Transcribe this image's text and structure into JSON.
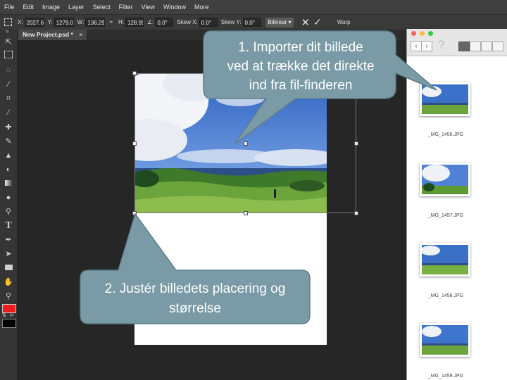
{
  "menu": [
    "File",
    "Edit",
    "Image",
    "Layer",
    "Select",
    "Filter",
    "View",
    "Window",
    "More"
  ],
  "options": {
    "x_label": "X:",
    "x_value": "2027.6",
    "y_label": "Y:",
    "y_value": "1279.0",
    "w_label": "W:",
    "w_value": "136.29",
    "link_symbol": "=",
    "h_label": "H:",
    "h_value": "128.99",
    "angle_label": "∠:",
    "angle_value": "0.0°",
    "skewx_label": "Skew X:",
    "skewx_value": "0.0°",
    "skewy_label": "Skew Y:",
    "skewy_value": "0.0°",
    "interpolation": "Bilinear",
    "warp_label": "Warp"
  },
  "document_tab": {
    "title": "New Project.psd *",
    "close_glyph": "×"
  },
  "toolbar_collapse": "»",
  "swap_labels": [
    "⇅",
    "D"
  ],
  "colors": {
    "foreground": "#ee1c1c",
    "background": "#000000",
    "callout_fill": "#7a9aa6",
    "callout_stroke": "#5c7f8c"
  },
  "callouts": {
    "import_lines": [
      "1. Importer dit billede",
      "ved at trække det direkte",
      "ind fra fil-finderen"
    ],
    "adjust_lines": [
      "2. Justér billedets placering og",
      "størrelse"
    ]
  },
  "finder": {
    "files": [
      "_MG_1456.JPG",
      "_MG_1457.JPG",
      "_MG_1458.JPG",
      "_MG_1459.JPG"
    ],
    "help_glyph": "?"
  }
}
